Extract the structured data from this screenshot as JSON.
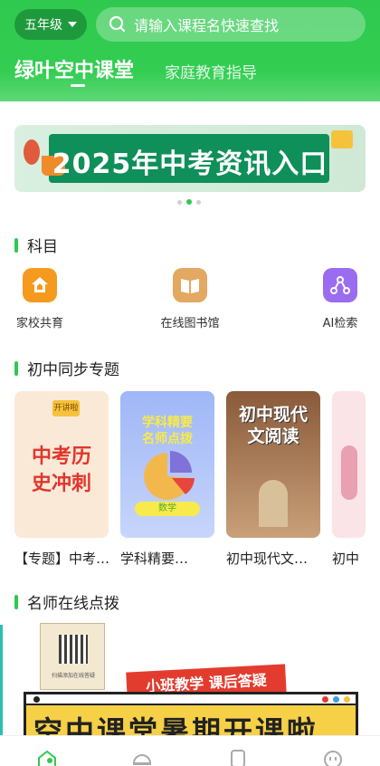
{
  "header": {
    "grade": "五年级",
    "search_placeholder": "请输入课程名快速查找",
    "tab_active": "绿叶空中课堂",
    "tab_other": "家庭教育指导"
  },
  "banner": {
    "text": "2025年中考资讯入口"
  },
  "subjects": {
    "title": "科目",
    "items": [
      {
        "label": "家校共育",
        "icon": "home-school-icon",
        "color": "#f59a1e"
      },
      {
        "label": "在线图书馆",
        "icon": "book-icon",
        "color": "#e3a861"
      },
      {
        "label": "AI检索",
        "icon": "ai-search-icon",
        "color": "#9b6cf0"
      }
    ]
  },
  "sync": {
    "title": "初中同步专题",
    "cards": [
      {
        "label": "【专题】中考…",
        "art_tag": "开讲啦",
        "art_text": "中考历史冲刺"
      },
      {
        "label": "学科精要…",
        "art_text": "学科精要 名师点拨",
        "art_sub": "数学"
      },
      {
        "label": "初中现代文…",
        "art_text": "初中现代文阅读"
      },
      {
        "label": "初中"
      }
    ]
  },
  "teacher": {
    "title": "名师在线点拨",
    "stamp": "小班教学 课后答疑",
    "headline": "空中课堂暑期开课啦",
    "qr_caption": "扫描添加在线答疑"
  },
  "colors": {
    "brand": "#2fc94f",
    "brand_dark": "#1e9a3c"
  }
}
